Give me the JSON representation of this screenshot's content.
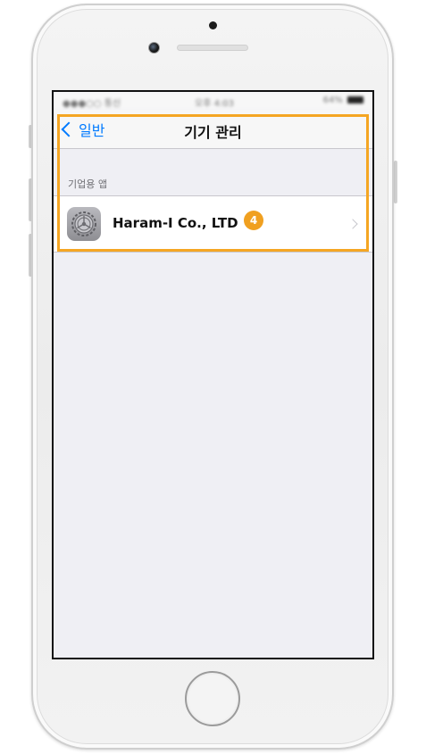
{
  "status_bar": {
    "carrier": "●●●○○ 통신",
    "time": "오후 4:03",
    "battery": "64%"
  },
  "nav": {
    "back_label": "일반",
    "title": "기기 관리"
  },
  "section": {
    "header": "기업용 앱"
  },
  "profile_cell": {
    "title": "Haram-I Co., LTD",
    "icon": "settings-gear-icon"
  },
  "annotation": {
    "step_number": "4",
    "highlight_color": "#f5a623"
  },
  "colors": {
    "ios_blue": "#007aff",
    "background": "#efeff4"
  }
}
